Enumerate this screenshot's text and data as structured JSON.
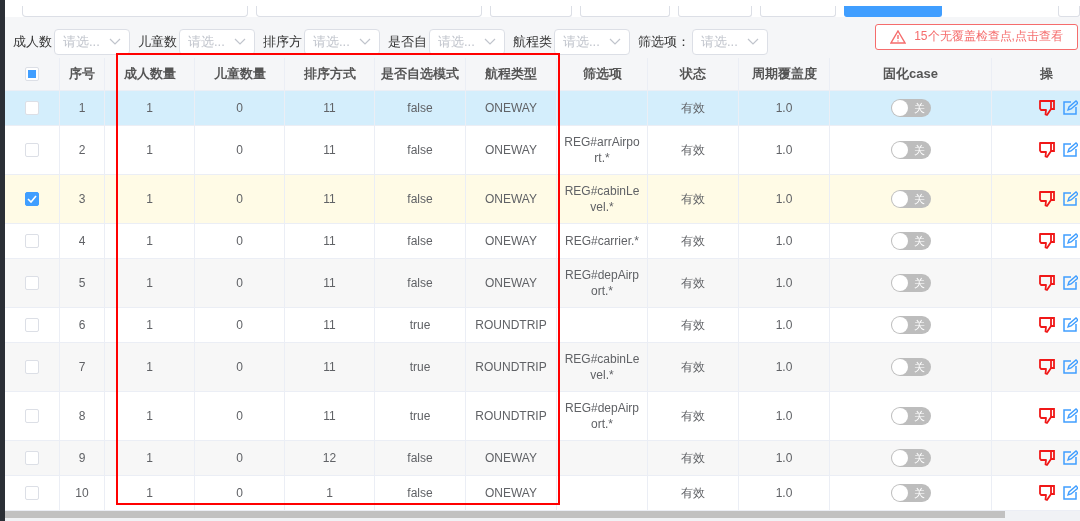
{
  "filters": [
    {
      "label": "成人数",
      "placeholder": "请选..."
    },
    {
      "label": "儿童数",
      "placeholder": "请选..."
    },
    {
      "label": "排序方",
      "placeholder": "请选..."
    },
    {
      "label": "是否自",
      "placeholder": "请选..."
    },
    {
      "label": "航程类",
      "placeholder": "请选..."
    },
    {
      "label": "筛选项：",
      "placeholder": "请选..."
    }
  ],
  "alert": "15个无覆盖检查点,点击查看",
  "table": {
    "header_checkbox": {
      "indeterminate": true
    },
    "columns": [
      "序号",
      "成人数量",
      "儿童数量",
      "排序方式",
      "是否自选模式",
      "航程类型",
      "筛选项",
      "状态",
      "周期覆盖度",
      "固化case",
      "操"
    ],
    "rows": [
      {
        "checked": false,
        "hovered": true,
        "cells": [
          "1",
          "1",
          "0",
          "11",
          "false",
          "ONEWAY",
          "",
          "有效",
          "1.0"
        ],
        "switch": {
          "on": false,
          "label": "关"
        }
      },
      {
        "checked": false,
        "hovered": false,
        "cells": [
          "2",
          "1",
          "0",
          "11",
          "false",
          "ONEWAY",
          "REG#arrAirport.*",
          "有效",
          "1.0"
        ],
        "switch": {
          "on": false,
          "label": "关"
        }
      },
      {
        "checked": true,
        "hovered": false,
        "cells": [
          "3",
          "1",
          "0",
          "11",
          "false",
          "ONEWAY",
          "REG#cabinLevel.*",
          "有效",
          "1.0"
        ],
        "switch": {
          "on": false,
          "label": "关"
        }
      },
      {
        "checked": false,
        "hovered": false,
        "cells": [
          "4",
          "1",
          "0",
          "11",
          "false",
          "ONEWAY",
          "REG#carrier.*",
          "有效",
          "1.0"
        ],
        "switch": {
          "on": false,
          "label": "关"
        }
      },
      {
        "checked": false,
        "hovered": false,
        "cells": [
          "5",
          "1",
          "0",
          "11",
          "false",
          "ONEWAY",
          "REG#depAirport.*",
          "有效",
          "1.0"
        ],
        "switch": {
          "on": false,
          "label": "关"
        }
      },
      {
        "checked": false,
        "hovered": false,
        "cells": [
          "6",
          "1",
          "0",
          "11",
          "true",
          "ROUNDTRIP",
          "",
          "有效",
          "1.0"
        ],
        "switch": {
          "on": false,
          "label": "关"
        }
      },
      {
        "checked": false,
        "hovered": false,
        "cells": [
          "7",
          "1",
          "0",
          "11",
          "true",
          "ROUNDTRIP",
          "REG#cabinLevel.*",
          "有效",
          "1.0"
        ],
        "switch": {
          "on": false,
          "label": "关"
        }
      },
      {
        "checked": false,
        "hovered": false,
        "cells": [
          "8",
          "1",
          "0",
          "11",
          "true",
          "ROUNDTRIP",
          "REG#depAirport.*",
          "有效",
          "1.0"
        ],
        "switch": {
          "on": false,
          "label": "关"
        }
      },
      {
        "checked": false,
        "hovered": false,
        "cells": [
          "9",
          "1",
          "0",
          "12",
          "false",
          "ONEWAY",
          "",
          "有效",
          "1.0"
        ],
        "switch": {
          "on": false,
          "label": "关"
        }
      },
      {
        "checked": false,
        "hovered": false,
        "cells": [
          "10",
          "1",
          "0",
          "1",
          "false",
          "ONEWAY",
          "",
          "有效",
          "1.0"
        ],
        "switch": {
          "on": false,
          "label": "关"
        }
      }
    ]
  }
}
